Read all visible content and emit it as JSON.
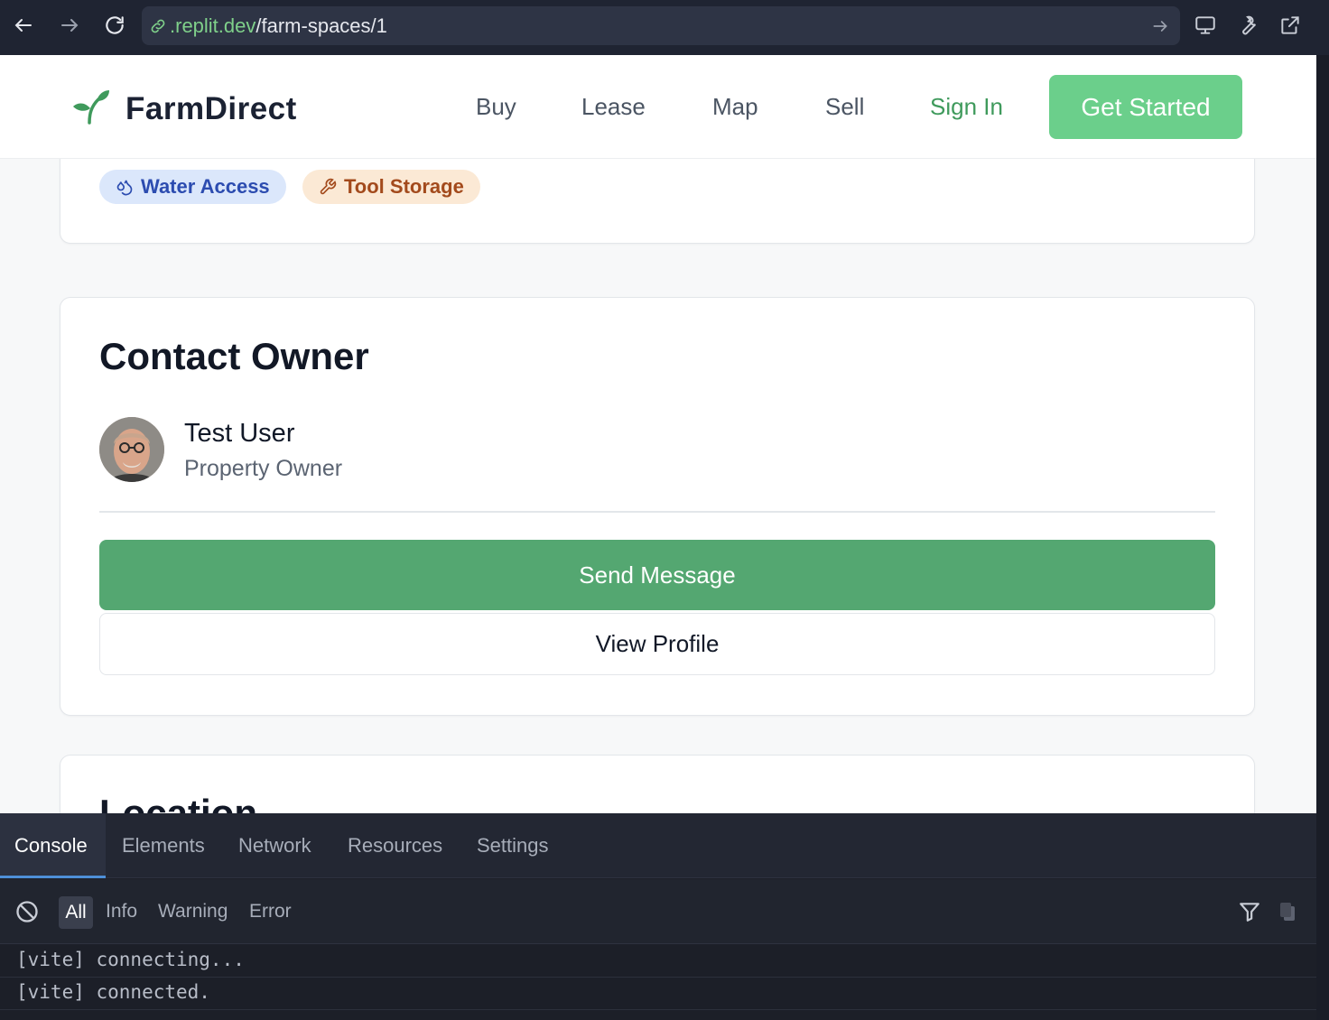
{
  "browser": {
    "url_host": ".replit.dev",
    "url_path": "/farm-spaces/1"
  },
  "header": {
    "brand": "FarmDirect",
    "nav": {
      "buy": "Buy",
      "lease": "Lease",
      "map": "Map",
      "sell": "Sell",
      "sign_in": "Sign In"
    },
    "cta": "Get Started"
  },
  "amenities": {
    "water": "Water Access",
    "tool": "Tool Storage"
  },
  "contact": {
    "title": "Contact Owner",
    "owner_name": "Test User",
    "owner_role": "Property Owner",
    "send_button": "Send Message",
    "profile_button": "View Profile"
  },
  "location": {
    "title": "Location"
  },
  "devtools": {
    "tabs": [
      "Console",
      "Elements",
      "Network",
      "Resources",
      "Settings"
    ],
    "filters": [
      "All",
      "Info",
      "Warning",
      "Error"
    ],
    "logs": [
      "[vite] connecting...",
      "[vite] connected."
    ]
  },
  "colors": {
    "brand_green": "#54a771",
    "cta_green": "#6bcf8b",
    "signin_green": "#3f9a5c",
    "water_tag_bg": "#dbe7fb",
    "tool_tag_bg": "#fbe9d5"
  }
}
